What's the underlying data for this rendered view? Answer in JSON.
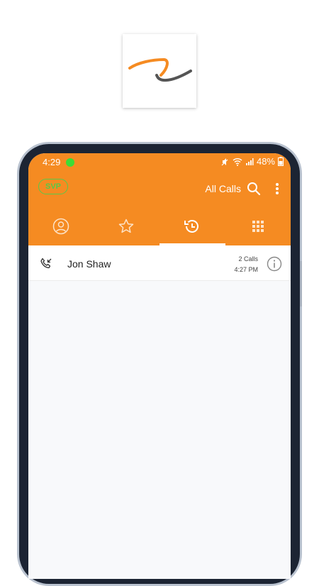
{
  "status_bar": {
    "time": "4:29",
    "battery": "48%"
  },
  "app_bar": {
    "badge": "SVP",
    "filter_label": "All Calls"
  },
  "tabs": [
    {
      "name": "contacts",
      "icon": "person-circle-icon"
    },
    {
      "name": "favorites",
      "icon": "star-icon"
    },
    {
      "name": "recents",
      "icon": "history-icon",
      "selected": true
    },
    {
      "name": "dialpad",
      "icon": "dialpad-icon"
    }
  ],
  "calls": [
    {
      "name": "Jon Shaw",
      "count": "2 Calls",
      "time": "4:27 PM",
      "icon": "incoming-call-icon"
    }
  ],
  "colors": {
    "accent": "#f58b22",
    "badge": "#57c94a"
  }
}
